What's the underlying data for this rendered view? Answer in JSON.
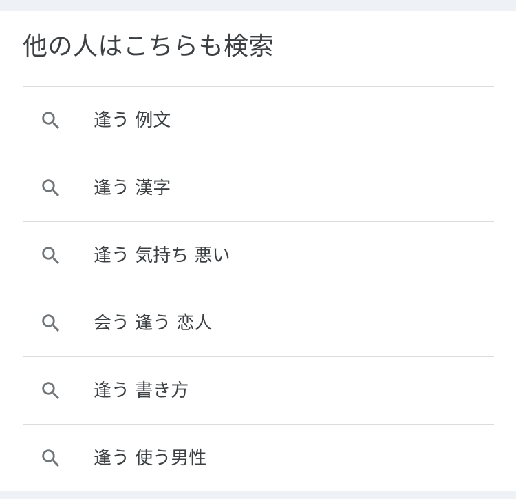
{
  "section": {
    "title": "他の人はこちらも検索",
    "items": [
      {
        "label": "逢う 例文",
        "icon": "search-icon"
      },
      {
        "label": "逢う 漢字",
        "icon": "search-icon"
      },
      {
        "label": "逢う 気持ち 悪い",
        "icon": "search-icon"
      },
      {
        "label": "会う 逢う 恋人",
        "icon": "search-icon"
      },
      {
        "label": "逢う 書き方",
        "icon": "search-icon"
      },
      {
        "label": "逢う 使う男性",
        "icon": "search-icon"
      }
    ]
  },
  "colors": {
    "page_background": "#eef1f5",
    "card_background": "#ffffff",
    "text": "#3c4043",
    "icon": "#70757a",
    "divider": "#dadce0"
  }
}
